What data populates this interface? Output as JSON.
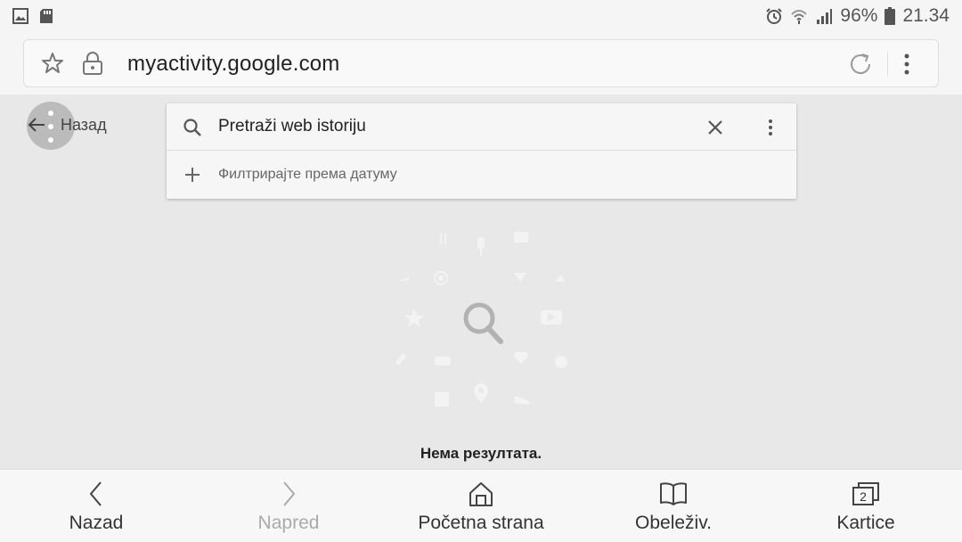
{
  "status_bar": {
    "battery": "96%",
    "time": "21.34",
    "left_icons": [
      "image-icon",
      "sd-card-icon"
    ],
    "right_icons": [
      "alarm-icon",
      "wifi-icon",
      "signal-icon",
      "battery-icon"
    ]
  },
  "toolbar": {
    "url": "myactivity.google.com",
    "icons": [
      "star-icon",
      "lock-icon",
      "reload-icon",
      "more-vert-icon"
    ]
  },
  "page": {
    "back_label": "Назад",
    "search_placeholder": "Pretraži web istoriju",
    "filter_label": "Филтрирајте према датуму",
    "empty_message": "Нема резултата."
  },
  "bottom_nav": {
    "items": [
      {
        "label": "Nazad",
        "icon": "chevron-left-icon"
      },
      {
        "label": "Napred",
        "icon": "chevron-right-icon",
        "disabled": true
      },
      {
        "label": "Početna strana",
        "icon": "home-icon"
      },
      {
        "label": "Obeleživ.",
        "icon": "bookmarks-icon"
      },
      {
        "label": "Kartice",
        "icon": "tabs-icon",
        "count": "2"
      }
    ]
  },
  "colors": {
    "page_bg": "#e8e8e8",
    "bar_bg": "#f5f5f5",
    "card_bg": "#f6f6f6",
    "disabled": "#aaaaaa"
  }
}
